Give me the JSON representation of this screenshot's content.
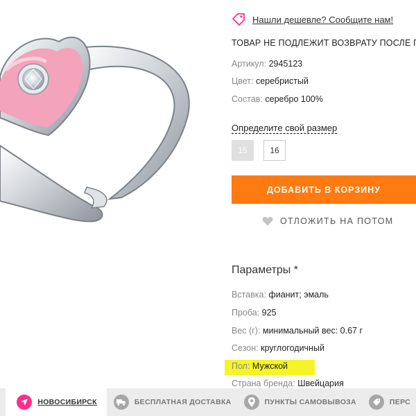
{
  "cheaper_link": "Нашли дешевле? Сообщите нам!",
  "no_return": "ТОВАР НЕ ПОДЛЕЖИТ ВОЗВРАТУ ПОСЛЕ П",
  "attributes": [
    {
      "key": "Артикул:",
      "value": "2945123"
    },
    {
      "key": "Цвет:",
      "value": "серебристый"
    },
    {
      "key": "Состав:",
      "value": "серебро 100%"
    }
  ],
  "size_selector": {
    "title": "Определите свой размер",
    "sizes": [
      "15",
      "16"
    ],
    "unavailable": "15"
  },
  "add_to_cart": "ДОБАВИТЬ В КОРЗИНУ",
  "save_for_later": "ОТЛОЖИТЬ НА ПОТОМ",
  "params": {
    "title": "Параметры *",
    "items": [
      {
        "key": "Вставка:",
        "value": "фианит; эмаль"
      },
      {
        "key": "Проба:",
        "value": "925"
      },
      {
        "key": "Вес (г):",
        "value": "минимальный вес: 0.67 г"
      },
      {
        "key": "Сезон:",
        "value": "круглогодичный"
      },
      {
        "key": "Пол:",
        "value": "Мужской"
      },
      {
        "key": "Страна бренда:",
        "value": "Швейцария"
      }
    ]
  },
  "bottom_bar": {
    "city": "НОВОСИБИРСК",
    "delivery": "БЕСПЛАТНАЯ ДОСТАВКА",
    "pickup": "ПУНКТЫ САМОВЫВОЗА",
    "last": "ПЕРС"
  },
  "colors": {
    "accent": "#ff7a10",
    "brand_pink": "#ff2d8c",
    "highlight": "#f6f327",
    "ring_enamel": "#f4a3bd"
  },
  "icons": [
    "tag-icon",
    "heart-icon",
    "location-arrow-icon",
    "truck-icon",
    "map-pin-icon",
    "tag-circle-icon"
  ]
}
